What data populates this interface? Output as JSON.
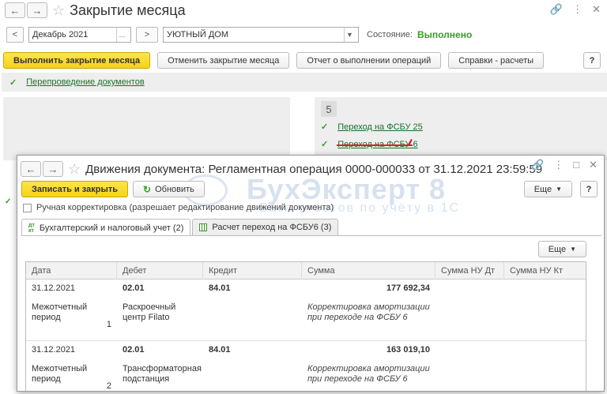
{
  "main": {
    "title": "Закрытие месяца",
    "period": "Декабрь 2021",
    "organization": "УЮТНЫЙ ДОМ",
    "state_label": "Состояние:",
    "state_value": "Выполнено",
    "buttons": {
      "execute": "Выполнить закрытие месяца",
      "cancel": "Отменить закрытие месяца",
      "report": "Отчет о выполнении операций",
      "help_calc": "Справки - расчеты",
      "help": "?"
    },
    "repost_link": "Перепроведение документов",
    "step_number": "5",
    "steps": [
      "Переход на ФСБУ 25",
      "Переход на ФСБУ 6"
    ]
  },
  "dialog": {
    "title": "Движения документа: Регламентная операция 0000-000033 от 31.12.2021 23:59:59",
    "save_close": "Записать и закрыть",
    "refresh": "Обновить",
    "more": "Еще",
    "help": "?",
    "manual_edit": "Ручная корректировка (разрешает редактирование движений документа)",
    "tabs": [
      "Бухгалтерский и налоговый учет (2)",
      "Расчет переход на ФСБУ6 (3)"
    ],
    "watermark_main": "БухЭксперт 8",
    "watermark_sub": "База ответов по учёту в 1С",
    "table": {
      "columns": [
        "Дата",
        "Дебет",
        "Кредит",
        "Сумма",
        "Сумма НУ Дт",
        "Сумма НУ Кт"
      ],
      "records": [
        {
          "date": "31.12.2021",
          "debit": "02.01",
          "credit": "84.01",
          "amount": "177 692,34",
          "type": "Межотчетный период",
          "number": "1",
          "debit_sub": "Раскроечный центр Filato",
          "comment": "Корректировка амортизации при переходе на ФСБУ 6"
        },
        {
          "date": "31.12.2021",
          "debit": "02.01",
          "credit": "84.01",
          "amount": "163 019,10",
          "type": "Межотчетный период",
          "number": "2",
          "debit_sub": "Трансформаторная подстанция",
          "comment": "Корректировка амортизации при переходе на ФСБУ 6"
        }
      ]
    }
  }
}
